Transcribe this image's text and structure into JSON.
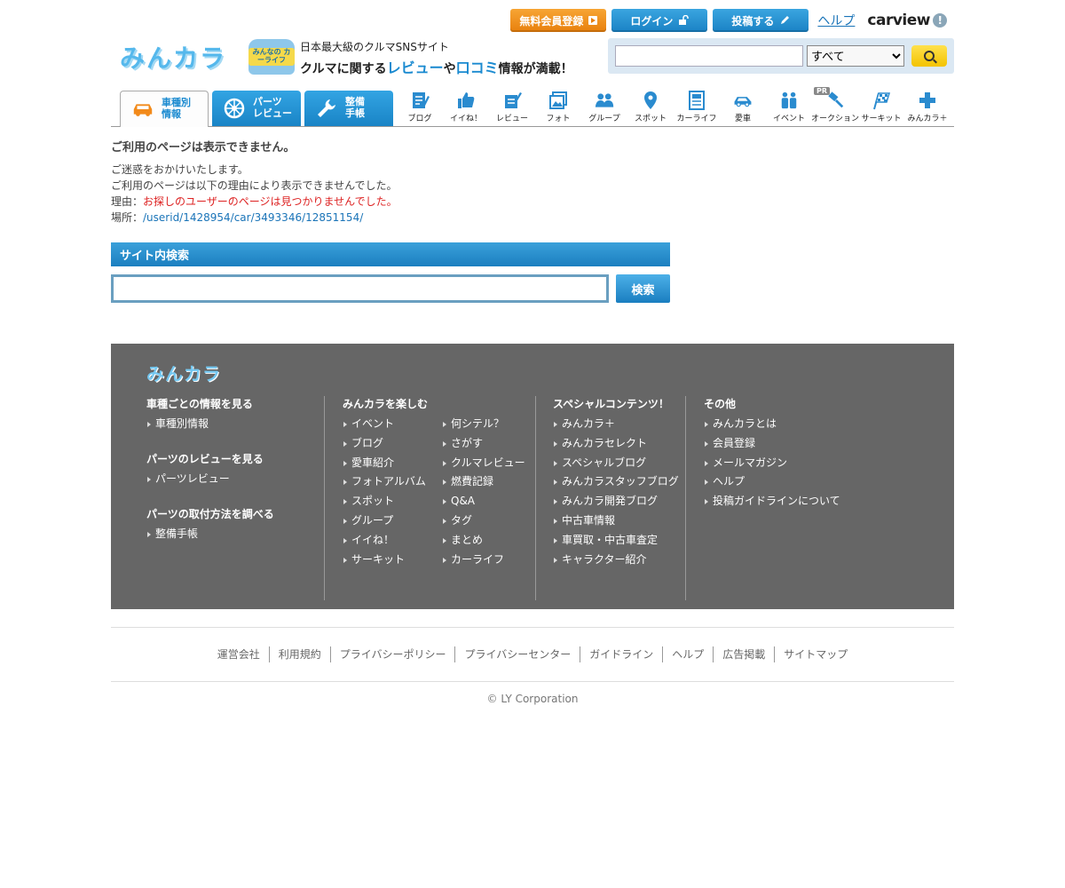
{
  "topbar": {
    "register_label": "無料会員登録",
    "login_label": "ログイン",
    "post_label": "投稿する",
    "help_label": "ヘルプ",
    "carview_label": "carview"
  },
  "header": {
    "logo_text": "みんカラ",
    "carlife_badge": "みんなの カーライフ",
    "tagline_line1": "日本最大級のクルマSNSサイト",
    "tagline_pre": "クルマに関する",
    "tagline_review": "レビュー",
    "tagline_ya": "や",
    "tagline_kuchikomi": "口コミ",
    "tagline_post": "情報が満載！"
  },
  "search": {
    "input_value": "",
    "select_value": "すべて"
  },
  "nav": {
    "tabs": [
      {
        "label1": "車種別",
        "label2": "情報"
      },
      {
        "label1": "パーツ",
        "label2": "レビュー"
      },
      {
        "label1": "整備",
        "label2": "手帳"
      }
    ],
    "icons": [
      {
        "label": "ブログ",
        "icon": "blog-icon"
      },
      {
        "label": "イイね！",
        "icon": "thumbs-up-icon"
      },
      {
        "label": "レビュー",
        "icon": "review-icon"
      },
      {
        "label": "フォト",
        "icon": "photo-icon"
      },
      {
        "label": "グループ",
        "icon": "group-icon"
      },
      {
        "label": "スポット",
        "icon": "map-pin-icon"
      },
      {
        "label": "カーライフ",
        "icon": "notebook-icon"
      },
      {
        "label": "愛車",
        "icon": "car-icon"
      },
      {
        "label": "イベント",
        "icon": "people-icon"
      },
      {
        "label": "オークション",
        "icon": "gavel-icon"
      },
      {
        "label": "サーキット",
        "icon": "checkered-flag-icon"
      },
      {
        "label": "みんカラ＋",
        "icon": "plus-icon"
      }
    ],
    "pr_badge": "PR"
  },
  "error": {
    "title": "ご利用のページは表示できません。",
    "line1": "ご迷惑をおかけいたします。",
    "line2": "ご利用のページは以下の理由により表示できませんでした。",
    "reason_label": "理由：",
    "reason_text": "お探しのユーザーのページは見つかりませんでした。",
    "place_label": "場所：",
    "place_text": "/userid/1428954/car/3493346/12851154/"
  },
  "site_search": {
    "heading": "サイト内検索",
    "button_label": "検索",
    "input_value": ""
  },
  "footer": {
    "logo_text": "みんカラ",
    "col1": {
      "groups": [
        {
          "title": "車種ごとの情報を見る",
          "items": [
            "車種別情報"
          ]
        },
        {
          "title": "パーツのレビューを見る",
          "items": [
            "パーツレビュー"
          ]
        },
        {
          "title": "パーツの取付方法を調べる",
          "items": [
            "整備手帳"
          ]
        }
      ]
    },
    "col2": {
      "title": "みんカラを楽しむ",
      "left": [
        "イベント",
        "ブログ",
        "愛車紹介",
        "フォトアルバム",
        "スポット",
        "グループ",
        "イイね！",
        "サーキット"
      ],
      "right": [
        "何シテル？",
        "さがす",
        "クルマレビュー",
        "燃費記録",
        "Q&A",
        "タグ",
        "まとめ",
        "カーライフ"
      ]
    },
    "col3": {
      "title": "スペシャルコンテンツ！",
      "items": [
        "みんカラ＋",
        "みんカラセレクト",
        "スペシャルブログ",
        "みんカラスタッフブログ",
        "みんカラ開発ブログ",
        "中古車情報",
        "車買取・中古車査定",
        "キャラクター紹介"
      ]
    },
    "col4": {
      "title": "その他",
      "items": [
        "みんカラとは",
        "会員登録",
        "メールマガジン",
        "ヘルプ",
        "投稿ガイドラインについて"
      ]
    }
  },
  "bottom_links": [
    "運営会社",
    "利用規約",
    "プライバシーポリシー",
    "プライバシーセンター",
    "ガイドライン",
    "ヘルプ",
    "広告掲載",
    "サイトマップ"
  ],
  "copyright": "© LY Corporation",
  "colors": {
    "brand_blue": "#1a8ad0",
    "orange": "#e8800d",
    "footer_bg": "#666666",
    "error_red": "#dd2222"
  }
}
